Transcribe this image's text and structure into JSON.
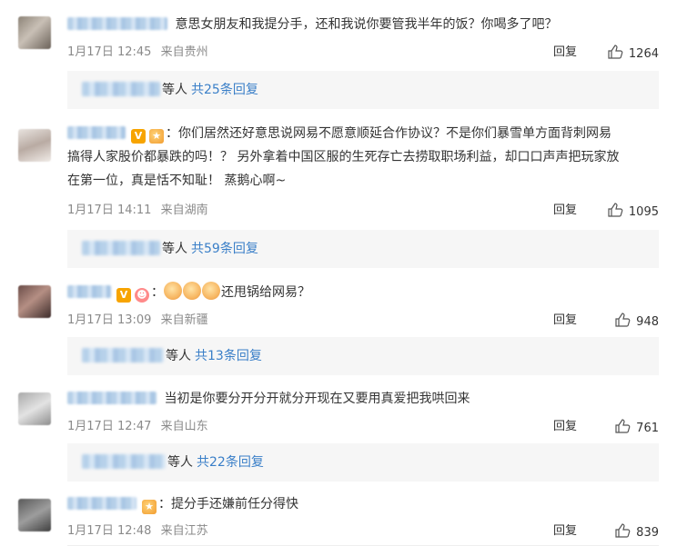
{
  "comments": [
    {
      "text": "意思女朋友和我提分手，还和我说你要管我半年的饭？你喝多了吧？",
      "time": "1月17日 12:45",
      "location": "来自贵州",
      "reply_label": "回复",
      "likes": "1264",
      "replies_etc": "等人",
      "replies_link": "共25条回复"
    },
    {
      "text_lines": [
        "你们居然还好意思说网易不愿意顺延合作协议？不是你们暴雪单方面背刺网易",
        "搞得人家股价都暴跌的吗！？ 另外拿着中国区服的生死存亡去捞取职场利益，却口口声声把玩家放",
        "在第一位，真是恬不知耻！ 蒸鹅心啊~"
      ],
      "time": "1月17日 14:11",
      "location": "来自湖南",
      "reply_label": "回复",
      "likes": "1095",
      "replies_etc": "等人",
      "replies_link": "共59条回复"
    },
    {
      "text": "还甩锅给网易？",
      "time": "1月17日 13:09",
      "location": "来自新疆",
      "reply_label": "回复",
      "likes": "948",
      "replies_etc": "等人",
      "replies_link": "共13条回复"
    },
    {
      "text": "当初是你要分开分开就分开现在又要用真爱把我哄回来",
      "time": "1月17日 12:47",
      "location": "来自山东",
      "reply_label": "回复",
      "likes": "761",
      "replies_etc": "等人",
      "replies_link": "共22条回复"
    },
    {
      "text": "提分手还嫌前任分得快",
      "time": "1月17日 12:48",
      "location": "来自江苏",
      "reply_label": "回复",
      "likes": "839"
    }
  ],
  "colors": {
    "link": "#3a7fc8",
    "meta": "#8a8a8a",
    "reply_bg": "#f6f6f6"
  },
  "icons": {
    "like": "thumbs-up-icon",
    "vip": "vip-v-badge-icon"
  }
}
